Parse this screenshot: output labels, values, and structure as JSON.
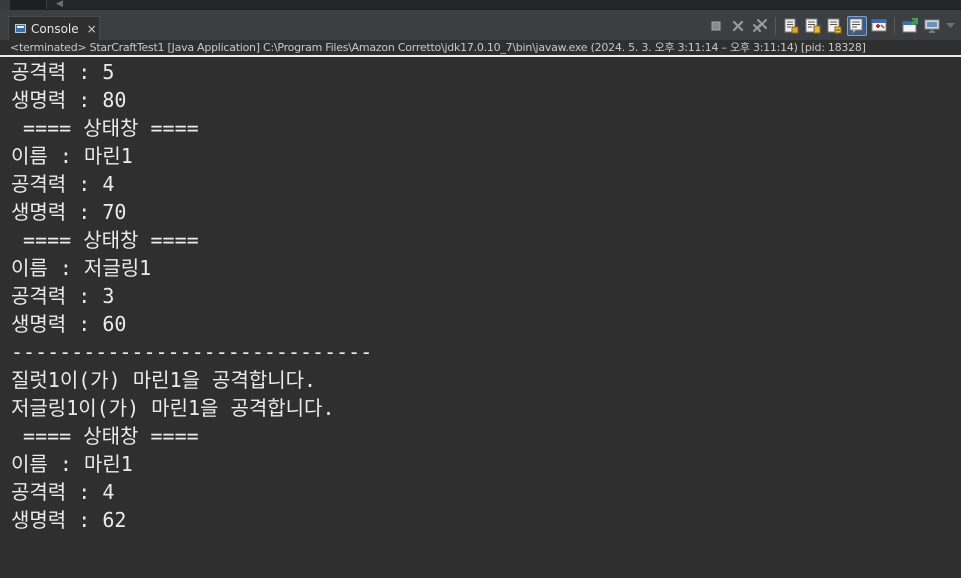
{
  "tab": {
    "label": "Console",
    "close_glyph": "×",
    "icon": "console-icon"
  },
  "toolbar": {
    "buttons": [
      {
        "name": "terminate-button",
        "icon": "stop-icon"
      },
      {
        "name": "remove-launch-button",
        "icon": "remove-icon"
      },
      {
        "name": "remove-all-terminated-button",
        "icon": "remove-all-icon"
      },
      {
        "name": "scroll-lock-button",
        "icon": "scroll-lock-icon"
      },
      {
        "name": "word-wrap-button",
        "icon": "word-wrap-icon"
      },
      {
        "name": "show-on-stdout-button",
        "icon": "show-stdout-icon"
      },
      {
        "name": "show-on-stderr-button",
        "icon": "show-stderr-icon"
      },
      {
        "name": "pin-console-button",
        "icon": "pin-icon"
      },
      {
        "name": "open-console-button",
        "icon": "new-console-icon"
      },
      {
        "name": "display-selected-console-button",
        "icon": "monitor-icon"
      },
      {
        "name": "view-menu-button",
        "icon": "chevron-down-icon"
      }
    ],
    "active_color": "#3d5c80"
  },
  "status": {
    "text": "<terminated> StarCraftTest1 [Java Application] C:\\Program Files\\Amazon Corretto\\jdk17.0.10_7\\bin\\javaw.exe  (2024. 5. 3. 오후 3:11:14 – 오후 3:11:14) [pid: 18328]"
  },
  "console": {
    "lines": [
      "공격력 : 5",
      "생명력 : 80",
      " ==== 상태창 ====",
      "이름 : 마린1",
      "공격력 : 4",
      "생명력 : 70",
      " ==== 상태창 ====",
      "이름 : 저글링1",
      "공격력 : 3",
      "생명력 : 60",
      "------------------------------",
      "질럿1이(가) 마린1을 공격합니다.",
      "저글링1이(가) 마린1을 공격합니다.",
      " ==== 상태창 ====",
      "이름 : 마린1",
      "공격력 : 4",
      "생명력 : 62"
    ],
    "text_color": "#ebebeb",
    "background": "#2f2f2f"
  }
}
